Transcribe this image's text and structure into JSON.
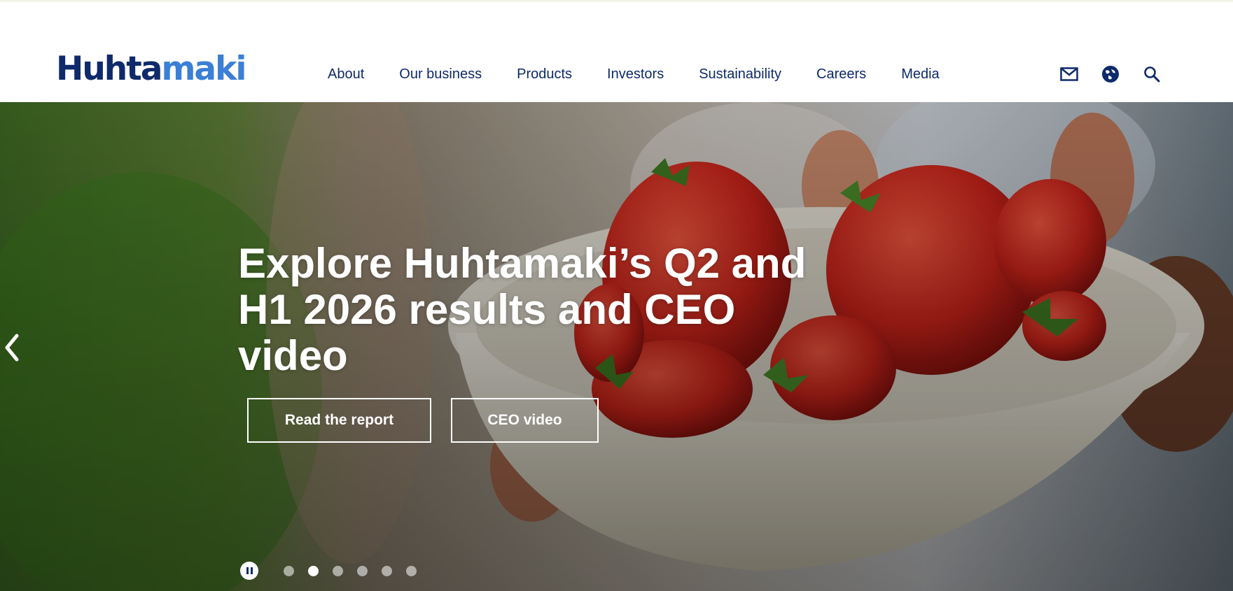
{
  "brand": {
    "logo_part1": "Huhta",
    "logo_part2": "maki",
    "primary_color": "#0f2a6b",
    "accent_color": "#3b7fd6"
  },
  "nav": {
    "items": [
      {
        "label": "About"
      },
      {
        "label": "Our business"
      },
      {
        "label": "Products"
      },
      {
        "label": "Investors"
      },
      {
        "label": "Sustainability"
      },
      {
        "label": "Careers"
      },
      {
        "label": "Media"
      }
    ]
  },
  "tools": {
    "icons": [
      "mail-icon",
      "globe-icon",
      "search-icon"
    ]
  },
  "hero": {
    "headline": "Explore Huhtamaki’s Q2 and H1 2026 results and CEO video",
    "buttons": [
      {
        "label": "Read the report"
      },
      {
        "label": "CEO video"
      }
    ],
    "carousel": {
      "slide_count": 6,
      "active_slide": 2
    }
  }
}
